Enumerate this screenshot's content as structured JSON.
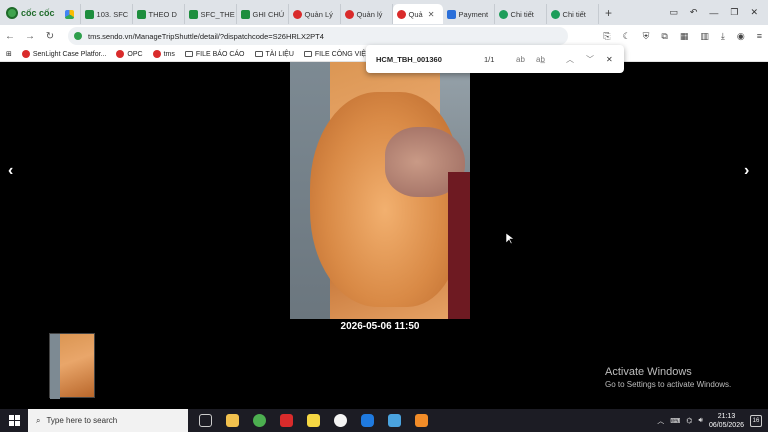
{
  "browser": {
    "brand_name": "cốc cốc",
    "tabs": [
      {
        "label": "",
        "icon": "drive-icon"
      },
      {
        "label": "103. SFC",
        "icon": "sheets-icon"
      },
      {
        "label": "THEO D",
        "icon": "sheets-icon"
      },
      {
        "label": "SFC_THE",
        "icon": "sheets-icon"
      },
      {
        "label": "GHI CHÚ",
        "icon": "sheets-icon"
      },
      {
        "label": "Quản Lý",
        "icon": "sendo-icon"
      },
      {
        "label": "Quản lý",
        "icon": "sendo-icon"
      },
      {
        "label": "Quả",
        "icon": "sendo-icon",
        "active": true
      },
      {
        "label": "Payment",
        "icon": "payment-icon"
      },
      {
        "label": "Chi tiết",
        "icon": "chrome-icon"
      },
      {
        "label": "Chi tiết",
        "icon": "chrome-icon"
      }
    ],
    "url": "tms.sendo.vn/ManageTripShuttle/detail/?dispatchcode=S26HRLX2PT4",
    "bookmarks": [
      {
        "label": "SenLight Case Platfor...",
        "icon": "sendo-icon"
      },
      {
        "label": "OPC",
        "icon": "sendo-icon"
      },
      {
        "label": "tms",
        "icon": "sendo-icon"
      },
      {
        "label": "FILE BÁO CÁO",
        "icon": "folder-icon"
      },
      {
        "label": "TÀI LIỆU",
        "icon": "folder-icon"
      },
      {
        "label": "FILE CÔNG VIỆC",
        "icon": "folder-icon"
      }
    ]
  },
  "find": {
    "query": "HCM_TBH_001360",
    "count": "1/1"
  },
  "viewer": {
    "caption": "2026-05-06 11:50",
    "prev_symbol": "‹",
    "next_symbol": "›"
  },
  "watermark": {
    "title": "Activate Windows",
    "subtitle": "Go to Settings to activate Windows."
  },
  "taskbar": {
    "search_placeholder": "Type here to search",
    "time": "21:13",
    "date": "06/05/2026",
    "notif_count": "16"
  }
}
